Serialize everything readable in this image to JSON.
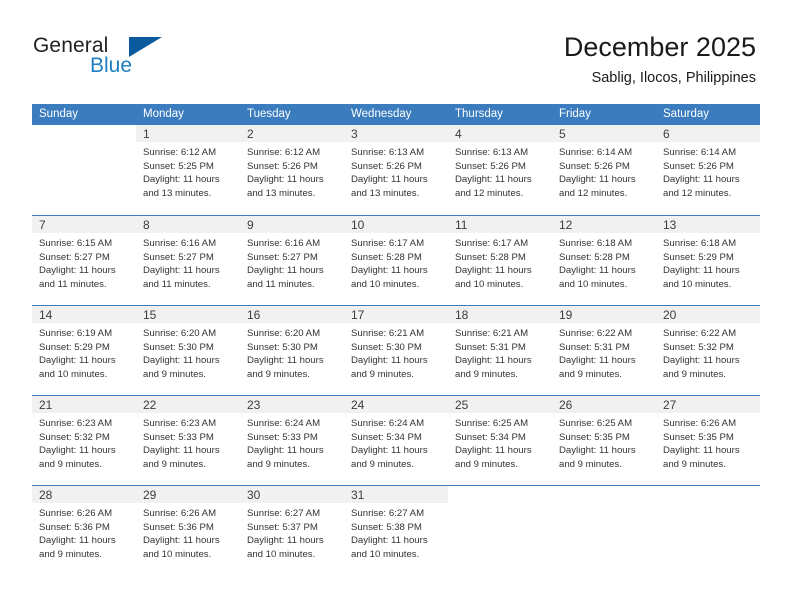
{
  "brand": {
    "word_one": "General",
    "word_two": "Blue",
    "logo_icon": "triangle-logo-icon",
    "color_dark": "#231f20",
    "color_blue": "#1e7fc4",
    "color_triangle": "#0c5a9e"
  },
  "header": {
    "title": "December 2025",
    "subtitle": "Sablig, Ilocos, Philippines"
  },
  "theme": {
    "header_row_bg": "#3a7cbe",
    "day_band_bg": "#f1f1f1",
    "text": "#333333"
  },
  "weekdays": [
    "Sunday",
    "Monday",
    "Tuesday",
    "Wednesday",
    "Thursday",
    "Friday",
    "Saturday"
  ],
  "weeks": [
    [
      {
        "day": "",
        "lines": []
      },
      {
        "day": "1",
        "lines": [
          "Sunrise: 6:12 AM",
          "Sunset: 5:25 PM",
          "Daylight: 11 hours",
          "and 13 minutes."
        ]
      },
      {
        "day": "2",
        "lines": [
          "Sunrise: 6:12 AM",
          "Sunset: 5:26 PM",
          "Daylight: 11 hours",
          "and 13 minutes."
        ]
      },
      {
        "day": "3",
        "lines": [
          "Sunrise: 6:13 AM",
          "Sunset: 5:26 PM",
          "Daylight: 11 hours",
          "and 13 minutes."
        ]
      },
      {
        "day": "4",
        "lines": [
          "Sunrise: 6:13 AM",
          "Sunset: 5:26 PM",
          "Daylight: 11 hours",
          "and 12 minutes."
        ]
      },
      {
        "day": "5",
        "lines": [
          "Sunrise: 6:14 AM",
          "Sunset: 5:26 PM",
          "Daylight: 11 hours",
          "and 12 minutes."
        ]
      },
      {
        "day": "6",
        "lines": [
          "Sunrise: 6:14 AM",
          "Sunset: 5:26 PM",
          "Daylight: 11 hours",
          "and 12 minutes."
        ]
      }
    ],
    [
      {
        "day": "7",
        "lines": [
          "Sunrise: 6:15 AM",
          "Sunset: 5:27 PM",
          "Daylight: 11 hours",
          "and 11 minutes."
        ]
      },
      {
        "day": "8",
        "lines": [
          "Sunrise: 6:16 AM",
          "Sunset: 5:27 PM",
          "Daylight: 11 hours",
          "and 11 minutes."
        ]
      },
      {
        "day": "9",
        "lines": [
          "Sunrise: 6:16 AM",
          "Sunset: 5:27 PM",
          "Daylight: 11 hours",
          "and 11 minutes."
        ]
      },
      {
        "day": "10",
        "lines": [
          "Sunrise: 6:17 AM",
          "Sunset: 5:28 PM",
          "Daylight: 11 hours",
          "and 10 minutes."
        ]
      },
      {
        "day": "11",
        "lines": [
          "Sunrise: 6:17 AM",
          "Sunset: 5:28 PM",
          "Daylight: 11 hours",
          "and 10 minutes."
        ]
      },
      {
        "day": "12",
        "lines": [
          "Sunrise: 6:18 AM",
          "Sunset: 5:28 PM",
          "Daylight: 11 hours",
          "and 10 minutes."
        ]
      },
      {
        "day": "13",
        "lines": [
          "Sunrise: 6:18 AM",
          "Sunset: 5:29 PM",
          "Daylight: 11 hours",
          "and 10 minutes."
        ]
      }
    ],
    [
      {
        "day": "14",
        "lines": [
          "Sunrise: 6:19 AM",
          "Sunset: 5:29 PM",
          "Daylight: 11 hours",
          "and 10 minutes."
        ]
      },
      {
        "day": "15",
        "lines": [
          "Sunrise: 6:20 AM",
          "Sunset: 5:30 PM",
          "Daylight: 11 hours",
          "and 9 minutes."
        ]
      },
      {
        "day": "16",
        "lines": [
          "Sunrise: 6:20 AM",
          "Sunset: 5:30 PM",
          "Daylight: 11 hours",
          "and 9 minutes."
        ]
      },
      {
        "day": "17",
        "lines": [
          "Sunrise: 6:21 AM",
          "Sunset: 5:30 PM",
          "Daylight: 11 hours",
          "and 9 minutes."
        ]
      },
      {
        "day": "18",
        "lines": [
          "Sunrise: 6:21 AM",
          "Sunset: 5:31 PM",
          "Daylight: 11 hours",
          "and 9 minutes."
        ]
      },
      {
        "day": "19",
        "lines": [
          "Sunrise: 6:22 AM",
          "Sunset: 5:31 PM",
          "Daylight: 11 hours",
          "and 9 minutes."
        ]
      },
      {
        "day": "20",
        "lines": [
          "Sunrise: 6:22 AM",
          "Sunset: 5:32 PM",
          "Daylight: 11 hours",
          "and 9 minutes."
        ]
      }
    ],
    [
      {
        "day": "21",
        "lines": [
          "Sunrise: 6:23 AM",
          "Sunset: 5:32 PM",
          "Daylight: 11 hours",
          "and 9 minutes."
        ]
      },
      {
        "day": "22",
        "lines": [
          "Sunrise: 6:23 AM",
          "Sunset: 5:33 PM",
          "Daylight: 11 hours",
          "and 9 minutes."
        ]
      },
      {
        "day": "23",
        "lines": [
          "Sunrise: 6:24 AM",
          "Sunset: 5:33 PM",
          "Daylight: 11 hours",
          "and 9 minutes."
        ]
      },
      {
        "day": "24",
        "lines": [
          "Sunrise: 6:24 AM",
          "Sunset: 5:34 PM",
          "Daylight: 11 hours",
          "and 9 minutes."
        ]
      },
      {
        "day": "25",
        "lines": [
          "Sunrise: 6:25 AM",
          "Sunset: 5:34 PM",
          "Daylight: 11 hours",
          "and 9 minutes."
        ]
      },
      {
        "day": "26",
        "lines": [
          "Sunrise: 6:25 AM",
          "Sunset: 5:35 PM",
          "Daylight: 11 hours",
          "and 9 minutes."
        ]
      },
      {
        "day": "27",
        "lines": [
          "Sunrise: 6:26 AM",
          "Sunset: 5:35 PM",
          "Daylight: 11 hours",
          "and 9 minutes."
        ]
      }
    ],
    [
      {
        "day": "28",
        "lines": [
          "Sunrise: 6:26 AM",
          "Sunset: 5:36 PM",
          "Daylight: 11 hours",
          "and 9 minutes."
        ]
      },
      {
        "day": "29",
        "lines": [
          "Sunrise: 6:26 AM",
          "Sunset: 5:36 PM",
          "Daylight: 11 hours",
          "and 10 minutes."
        ]
      },
      {
        "day": "30",
        "lines": [
          "Sunrise: 6:27 AM",
          "Sunset: 5:37 PM",
          "Daylight: 11 hours",
          "and 10 minutes."
        ]
      },
      {
        "day": "31",
        "lines": [
          "Sunrise: 6:27 AM",
          "Sunset: 5:38 PM",
          "Daylight: 11 hours",
          "and 10 minutes."
        ]
      },
      {
        "day": "",
        "lines": []
      },
      {
        "day": "",
        "lines": []
      },
      {
        "day": "",
        "lines": []
      }
    ]
  ]
}
